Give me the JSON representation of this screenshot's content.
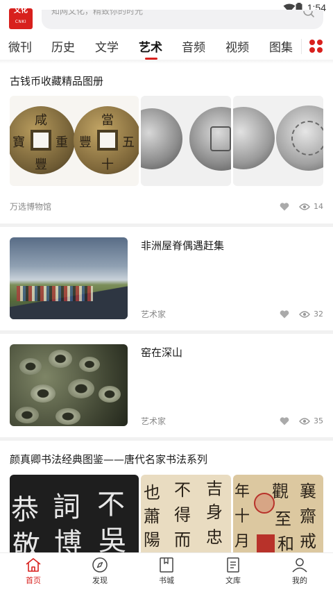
{
  "status_bar": {
    "time": "1:54"
  },
  "header": {
    "logo_top": "文化",
    "logo_bottom": "CNKI",
    "search_placeholder": "知网文化，精致你的时光"
  },
  "tabs": [
    {
      "label": "微刊",
      "active": false
    },
    {
      "label": "历史",
      "active": false
    },
    {
      "label": "文学",
      "active": false
    },
    {
      "label": "艺术",
      "active": true
    },
    {
      "label": "音频",
      "active": false
    },
    {
      "label": "视频",
      "active": false
    },
    {
      "label": "图集",
      "active": false
    }
  ],
  "feed": [
    {
      "title": "古钱币收藏精品图册",
      "source": "万选博物馆",
      "views": "14"
    },
    {
      "title": "非洲屋脊偶遇赶集",
      "source": "艺术家",
      "views": "32"
    },
    {
      "title": "窑在深山",
      "source": "艺术家",
      "views": "35"
    },
    {
      "title": "颜真卿书法经典图鉴——唐代名家书法系列"
    }
  ],
  "calligraphy_chars": {
    "a": [
      "恭",
      "詞",
      "不",
      "敬",
      "博",
      "吳"
    ],
    "b": [
      "也",
      "不",
      "吉",
      "蕭",
      "得",
      "身",
      "陽",
      "而",
      "忠"
    ],
    "c": [
      "觀",
      "襄",
      "年",
      "十",
      "齋",
      "月",
      "至",
      "戒",
      "和"
    ]
  },
  "coin_chars": {
    "a": [
      "咸",
      "豐",
      "重",
      "寶"
    ],
    "b": [
      "當",
      "十",
      "五",
      "豐"
    ]
  },
  "bottom_nav": [
    {
      "label": "首页",
      "icon": "home-icon",
      "active": true
    },
    {
      "label": "发现",
      "icon": "compass-icon",
      "active": false
    },
    {
      "label": "书城",
      "icon": "book-icon",
      "active": false
    },
    {
      "label": "文库",
      "icon": "document-icon",
      "active": false
    },
    {
      "label": "我的",
      "icon": "user-icon",
      "active": false
    }
  ],
  "colors": {
    "accent": "#d8201d",
    "text": "#222222",
    "muted": "#888888"
  }
}
